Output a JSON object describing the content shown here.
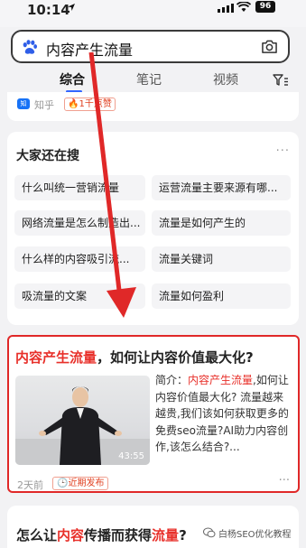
{
  "status_bar": {
    "time": "10:14",
    "battery": "96"
  },
  "search": {
    "query": "内容产生流量"
  },
  "tabs": [
    {
      "label": "综合",
      "active": true
    },
    {
      "label": "笔记",
      "active": false
    },
    {
      "label": "视频",
      "active": false
    }
  ],
  "source_card": {
    "site": "知乎",
    "hot_badge": "1千点赞"
  },
  "related": {
    "title": "大家还在搜",
    "more": "···",
    "items": [
      "什么叫统一营销流量",
      "运营流量主要来源有哪...",
      "网络流量是怎么制造出...",
      "流量是如何产生的",
      "什么样的内容吸引流...",
      "流量关键词",
      "吸流量的文案",
      "流量如何盈利"
    ]
  },
  "result": {
    "title_highlight": "内容产生流量",
    "title_rest": "，如何让内容价值最大化?",
    "video_duration": "43:55",
    "snippet_prefix": "简介：",
    "snippet_highlight": "内容产生流量",
    "snippet_rest": ",如何让内容价值最大化? 流量越来越贵,我们该如何获取更多的免费seo流量?AI助力内容创作,该怎么结合?...",
    "age": "2天前",
    "badge": "近期发布",
    "more": "···"
  },
  "next_result": {
    "title_a": "怎么让",
    "title_b": "内容",
    "title_c": "传播而获得",
    "title_d": "流量",
    "title_e": "?"
  },
  "watermark": "白杨SEO优化教程",
  "colors": {
    "accent": "#3366ff",
    "highlight": "#e8302a",
    "annotation": "#e02828"
  }
}
